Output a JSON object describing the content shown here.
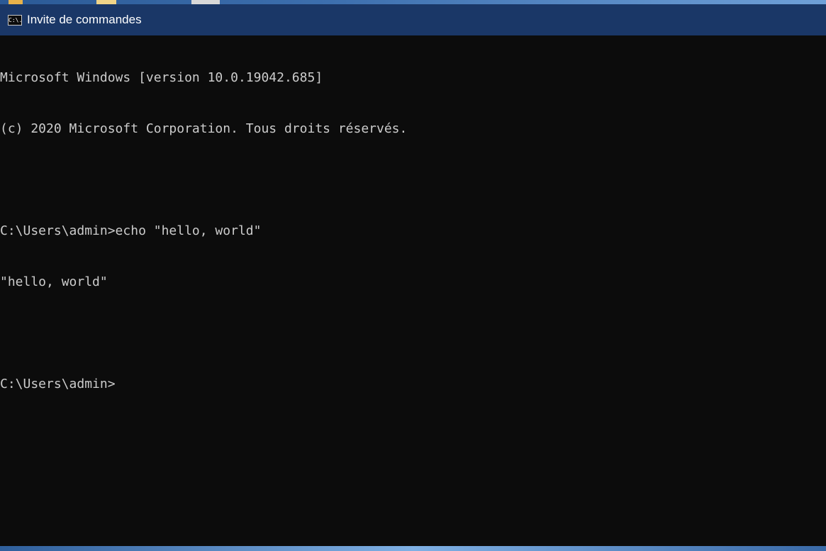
{
  "window": {
    "title": "Invite de commandes",
    "icon": "cmd-icon",
    "icon_label": "C:\\."
  },
  "console": {
    "lines": [
      "Microsoft Windows [version 10.0.19042.685]",
      "(c) 2020 Microsoft Corporation. Tous droits réservés.",
      "",
      "C:\\Users\\admin>echo \"hello, world\"",
      "\"hello, world\"",
      "",
      "C:\\Users\\admin>"
    ]
  },
  "colors": {
    "titlebar": "#1a3767",
    "console_bg": "#0c0c0c",
    "console_text": "#cccccc"
  }
}
